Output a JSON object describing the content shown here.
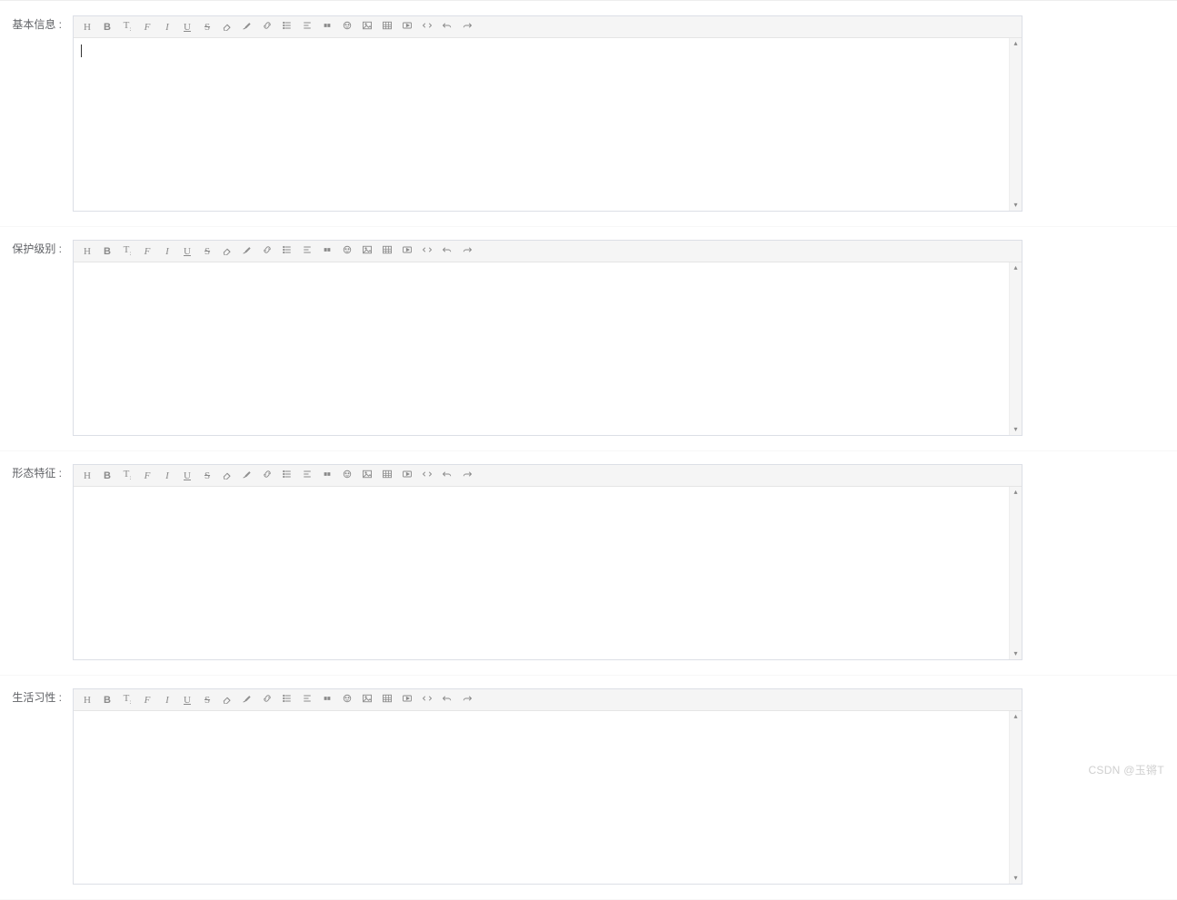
{
  "watermark": "CSDN @玉锵T",
  "toolbar": {
    "heading": "H",
    "bold": "B",
    "fontsize_indicator": "T",
    "fontfamily": "F",
    "italic": "I",
    "underline": "U",
    "strike": "S"
  },
  "sections": [
    {
      "key": "basic",
      "label": "基本信息 :",
      "has_cursor": true
    },
    {
      "key": "protect",
      "label": "保护级别 :",
      "has_cursor": false
    },
    {
      "key": "morph",
      "label": "形态特征 :",
      "has_cursor": false
    },
    {
      "key": "habit",
      "label": "生活习性 :",
      "has_cursor": false
    }
  ]
}
